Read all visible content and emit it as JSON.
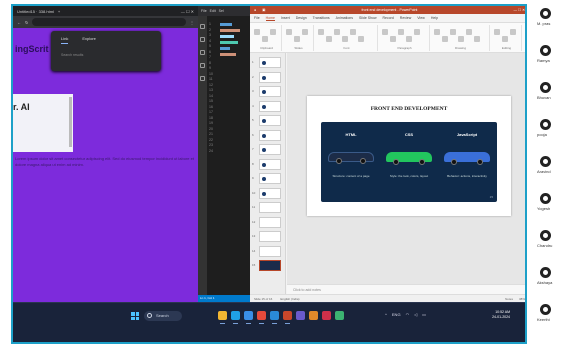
{
  "browser": {
    "tab_title": "Untitled15 · 338.html",
    "url": "",
    "page_heading": "ingScrit",
    "popup_tab_1": "Link",
    "popup_tab_2": "Explore",
    "popup_hint": "Search results",
    "card_text": "r. AI",
    "paragraph": "Lorem ipsum dolor sit amet consectetur adipiscing elit. Sed do eiusmod tempor incididunt ut labore et dolore magna aliqua ut enim ad minim."
  },
  "editor": {
    "menu": [
      "File",
      "Edit",
      "Sel"
    ],
    "line_numbers": [
      "1",
      "2",
      "3",
      "4",
      "5",
      "6",
      "7",
      "8",
      "9",
      "10",
      "11",
      "12",
      "13",
      "14",
      "15",
      "16",
      "17",
      "18",
      "19",
      "20",
      "21",
      "22",
      "23",
      "24"
    ],
    "status": "Ln 1, Col 1"
  },
  "ppt": {
    "window_title": "front end development - PowerPoint",
    "tabs": [
      "File",
      "Home",
      "Insert",
      "Design",
      "Transitions",
      "Animations",
      "Slide Show",
      "Record",
      "Review",
      "View",
      "Help"
    ],
    "active_tab": "Home",
    "ribbon_groups": [
      "Clipboard",
      "Slides",
      "Font",
      "Paragraph",
      "Drawing",
      "Editing"
    ],
    "slide_numbers": [
      "1",
      "2",
      "3",
      "4",
      "5",
      "6",
      "7",
      "8",
      "9",
      "10",
      "11",
      "12",
      "13",
      "14",
      "15"
    ],
    "notes_placeholder": "Click to add notes",
    "status_left": "Slide 15 of 16",
    "status_lang": "English (India)",
    "status_notes": "Notes",
    "status_zoom": "38%",
    "slide": {
      "title": "FRONT END DEVELOPMENT",
      "columns": [
        {
          "label": "HTML",
          "caption": "Structure: content of a page",
          "color": "#1c2c48"
        },
        {
          "label": "CSS",
          "caption": "Style: the look, colors, layout",
          "color": "#22c55e"
        },
        {
          "label": "JavaScript",
          "caption": "Behavior: actions, interactivity",
          "color": "#3a6fd8"
        }
      ],
      "page_number": "15"
    }
  },
  "taskbar": {
    "search_label": "Search",
    "tray_text": "ENG",
    "time": "10:52 AM",
    "date": "24-01-2024",
    "apps": [
      {
        "name": "files-icon",
        "color": "#f2b632"
      },
      {
        "name": "edge-icon",
        "color": "#1fa1e8"
      },
      {
        "name": "store-icon",
        "color": "#3a8ee6"
      },
      {
        "name": "chrome-icon",
        "color": "#e64a3b"
      },
      {
        "name": "vscode-icon",
        "color": "#2a8ad8"
      },
      {
        "name": "powerpoint-icon",
        "color": "#c8472b"
      },
      {
        "name": "teams-icon",
        "color": "#6a5acd"
      },
      {
        "name": "mail-icon",
        "color": "#e0892a"
      },
      {
        "name": "photos-icon",
        "color": "#d0304a"
      },
      {
        "name": "app-icon",
        "color": "#3cb371"
      }
    ]
  },
  "participants": [
    "M. pras",
    "Ramya",
    "Bhuvan",
    "pooja",
    "Aravind",
    "Yogesh",
    "Chandru",
    "Akshaya",
    "Keerthi"
  ]
}
